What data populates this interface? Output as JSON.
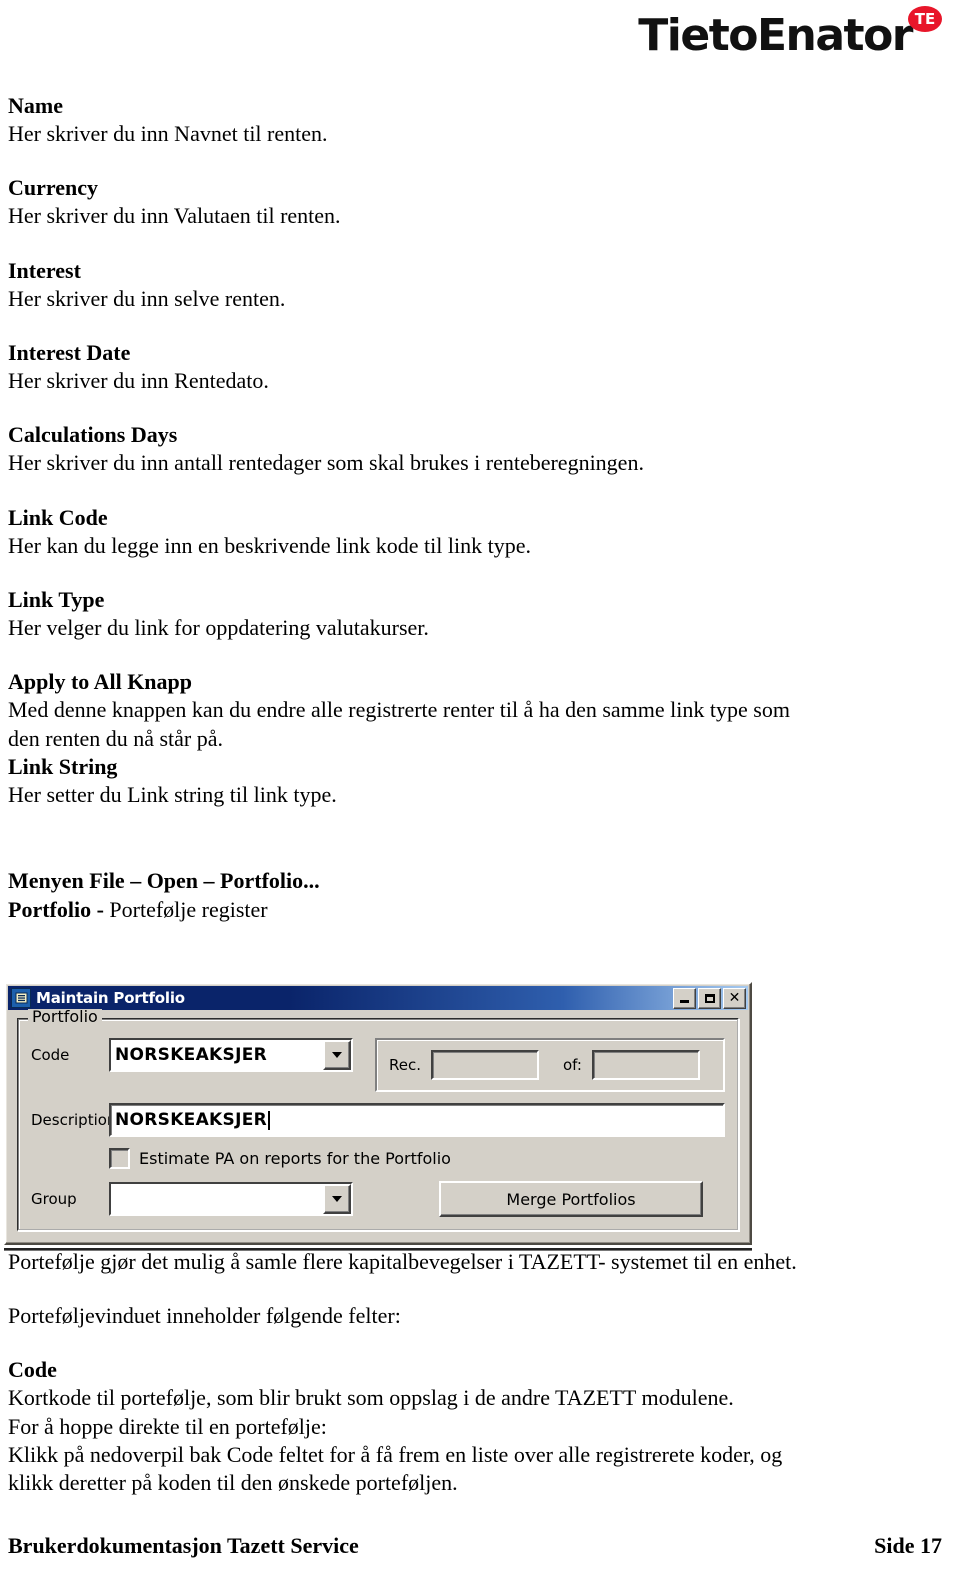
{
  "brand": {
    "wordmark": "TietoEnator",
    "badge": "TE",
    "badge_color": "#e8162a"
  },
  "fields": [
    {
      "term": "Name",
      "desc": "Her skriver du inn Navnet til renten."
    },
    {
      "term": "Currency",
      "desc": "Her skriver du inn Valutaen til renten."
    },
    {
      "term": "Interest",
      "desc": "Her skriver du inn selve renten."
    },
    {
      "term": "Interest Date",
      "desc": "Her skriver du inn Rentedato."
    },
    {
      "term": "Calculations Days",
      "desc": "Her skriver du inn antall rentedager som skal brukes i renteberegningen."
    },
    {
      "term": "Link Code",
      "desc": "Her kan du legge inn en beskrivende link kode til link type."
    },
    {
      "term": "Link Type",
      "desc": "Her velger du link for oppdatering valutakurser."
    }
  ],
  "apply_block": {
    "term": "Apply to All Knapp",
    "desc_line1": "Med denne knappen kan du endre alle registrerte renter til å ha den samme link type som",
    "desc_line2": "den renten du nå står på.",
    "term2": "Link String",
    "desc2": "Her setter du Link string til link type."
  },
  "menu_section": {
    "heading": "Menyen File – Open – Portfolio...",
    "subheading_bold": "Portfolio - ",
    "subheading_rest": "Portefølje register"
  },
  "dialog": {
    "title": "Maintain Portfolio",
    "icon": "document-window-icon",
    "window_buttons": {
      "minimize": "minimize-button",
      "maximize": "maximize-button",
      "close": "✕"
    },
    "group_legend": "Portfolio",
    "code_label": "Code",
    "code_value": "NORSKEAKSJER",
    "description_label": "Description",
    "description_value": "NORSKEAKSJER",
    "checkbox_label": "Estimate PA on reports for the Portfolio",
    "checkbox_checked": false,
    "group_label": "Group",
    "group_value": "",
    "rec_label": "Rec.",
    "rec_value": "",
    "of_label": "of:",
    "of_value": "",
    "merge_button": "Merge Portfolios"
  },
  "body_text": {
    "p1": "Portefølje gjør det mulig å samle flere kapitalbevegelser i TAZETT- systemet til en enhet.",
    "p2": "Porteføljevinduet inneholder følgende felter:",
    "code_term": "Code",
    "code_line1": "Kortkode til portefølje, som blir brukt som oppslag i de andre TAZETT modulene.",
    "code_line2": "For å hoppe direkte til en portefølje:",
    "code_line3": "Klikk på nedoverpil bak Code feltet for å få frem en liste over alle registrerete koder, og",
    "code_line4": "klikk deretter på koden til den ønskede porteføljen."
  },
  "footer": {
    "left": "Brukerdokumentasjon Tazett Service",
    "right": "Side 17"
  }
}
